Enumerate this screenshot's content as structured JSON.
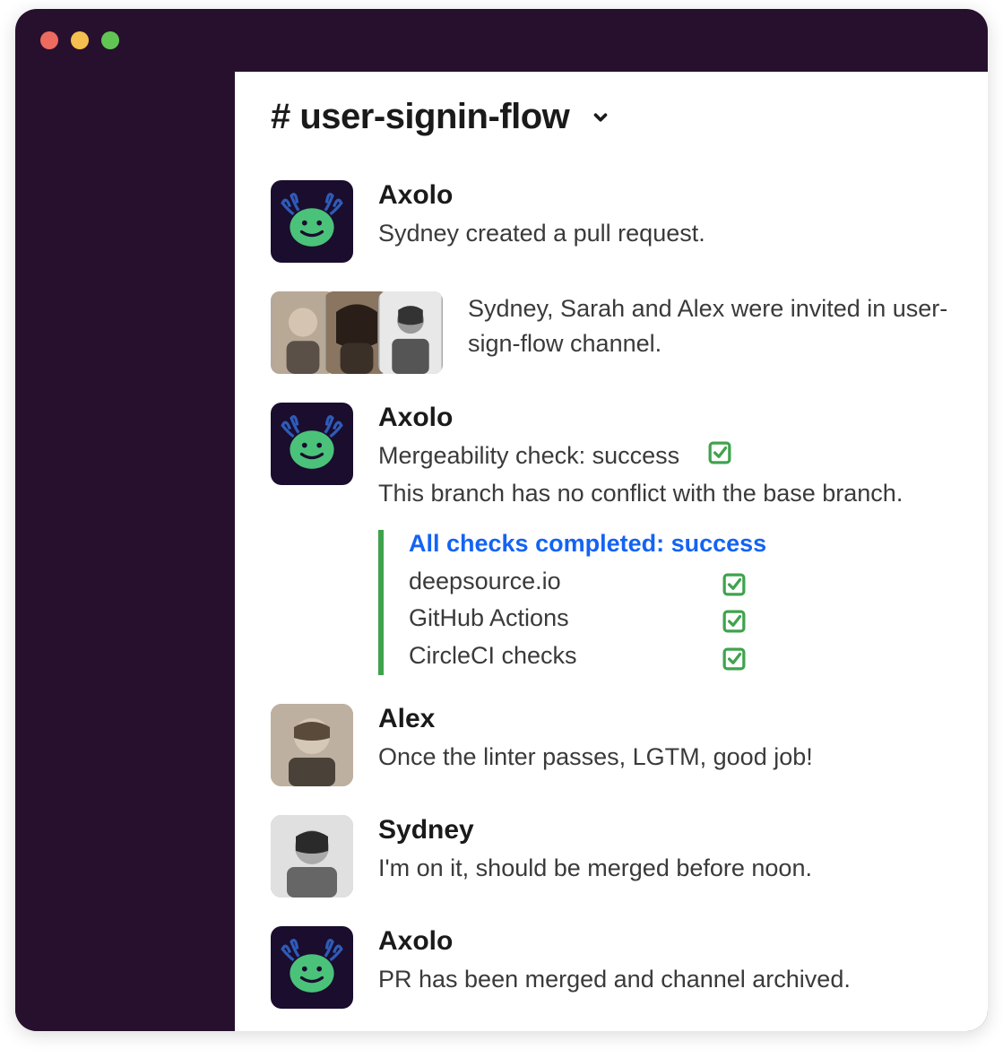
{
  "channel": {
    "name_prefix": "#",
    "name": "user-signin-flow"
  },
  "messages": [
    {
      "type": "bot",
      "author": "Axolo",
      "text": "Sydney created a pull request."
    },
    {
      "type": "system_invite",
      "text": "Sydney, Sarah and Alex were invited in user-sign-flow channel."
    },
    {
      "type": "bot",
      "author": "Axolo",
      "line1": "Mergeability check: success",
      "line2": "This branch has no conflict with the base branch."
    }
  ],
  "checks": {
    "title": "All checks completed: success",
    "items": [
      {
        "label": "deepsource.io",
        "status": "success"
      },
      {
        "label": "GitHub Actions",
        "status": "success"
      },
      {
        "label": "CircleCI checks",
        "status": "success"
      }
    ]
  },
  "messages2": [
    {
      "type": "user",
      "author": "Alex",
      "text": "Once the linter passes, LGTM, good job!"
    },
    {
      "type": "user",
      "author": "Sydney",
      "text": "I'm on it, should be merged before noon."
    },
    {
      "type": "bot",
      "author": "Axolo",
      "text": "PR has been merged and channel archived."
    }
  ],
  "colors": {
    "sidebar": "#27102e",
    "link": "#1463f3",
    "success": "#3fa34d"
  }
}
